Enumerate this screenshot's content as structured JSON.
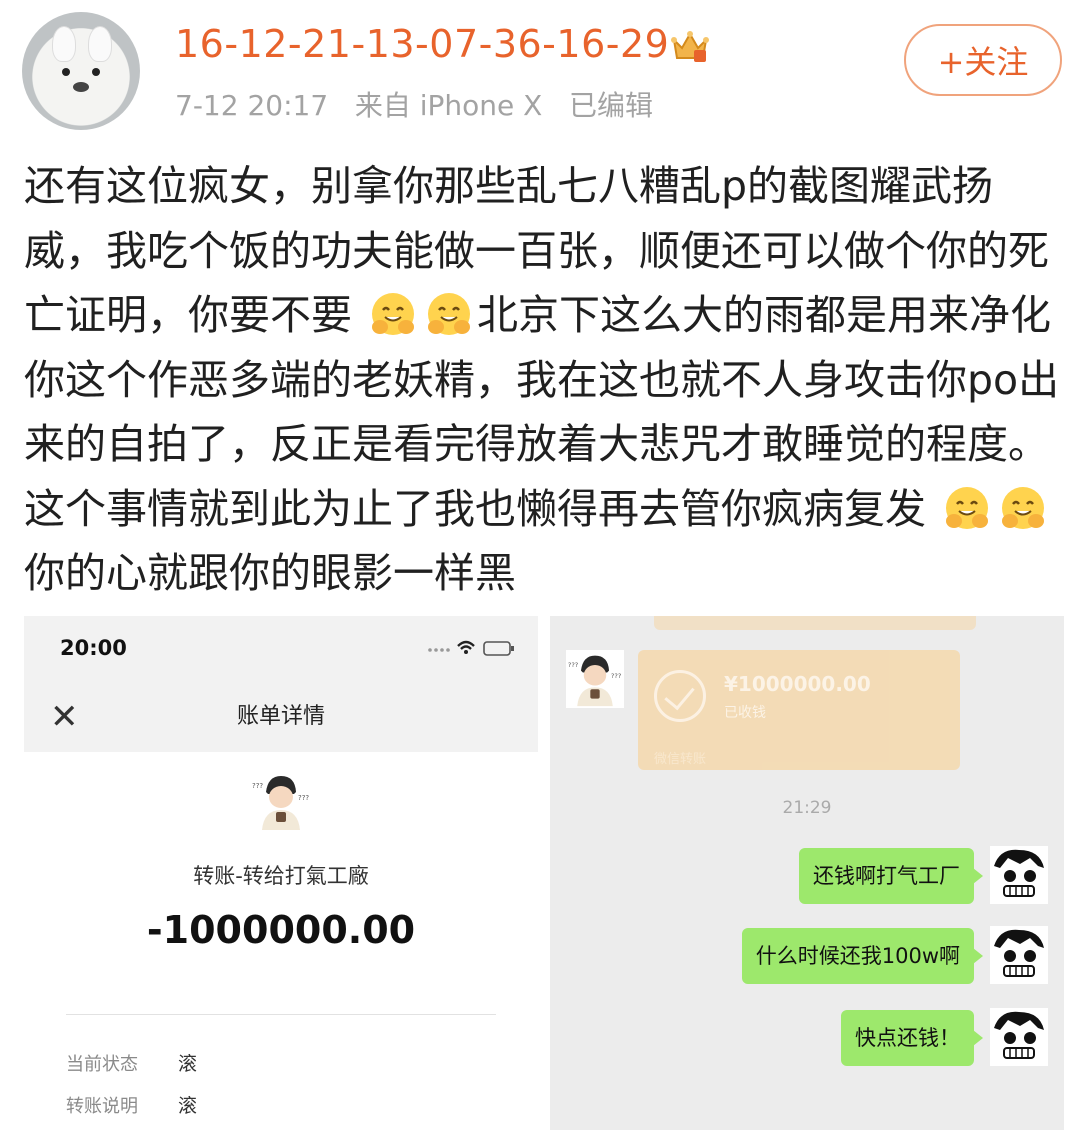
{
  "post": {
    "username": "16-12-21-13-07-36-16-29",
    "time": "7-12 20:17",
    "source": "来自 iPhone X",
    "edited": "已编辑",
    "follow_label": "+关注",
    "text_segments": [
      "还有这位疯女，别拿你那些乱七八糟乱p的截图耀武扬威，我吃个饭的功夫能做一百张，顺便还可以做个你的死亡证明，你要不要",
      "北京下这么大的雨都是用来净化你这个作恶多端的老妖精，我在这也就不人身攻击你po出来的自拍了，反正是看完得放着大悲咒才敢睡觉的程度。这个事情就到此为止了我也懒得再去管你疯病复发",
      "你的心就跟你的眼影一样黑"
    ],
    "emoji_name": "grin-hands-emoji"
  },
  "bill_screenshot": {
    "status_time": "20:00",
    "title": "账单详情",
    "transfer_text": "转账-转给打氣工廠",
    "amount": "-1000000.00",
    "rows": [
      {
        "label": "当前状态",
        "value": "滚"
      },
      {
        "label": "转账说明",
        "value": "滚"
      }
    ]
  },
  "chat_screenshot": {
    "transfer_amount": "¥1000000.00",
    "transfer_status": "已收钱",
    "transfer_label": "微信转账",
    "time": "21:29",
    "messages": [
      {
        "text": "还钱啊打气工厂"
      },
      {
        "text": "什么时候还我100w啊"
      },
      {
        "text": "快点还钱！"
      }
    ]
  },
  "colors": {
    "username": "#e8632c",
    "chat_bubble": "#9de86c"
  }
}
